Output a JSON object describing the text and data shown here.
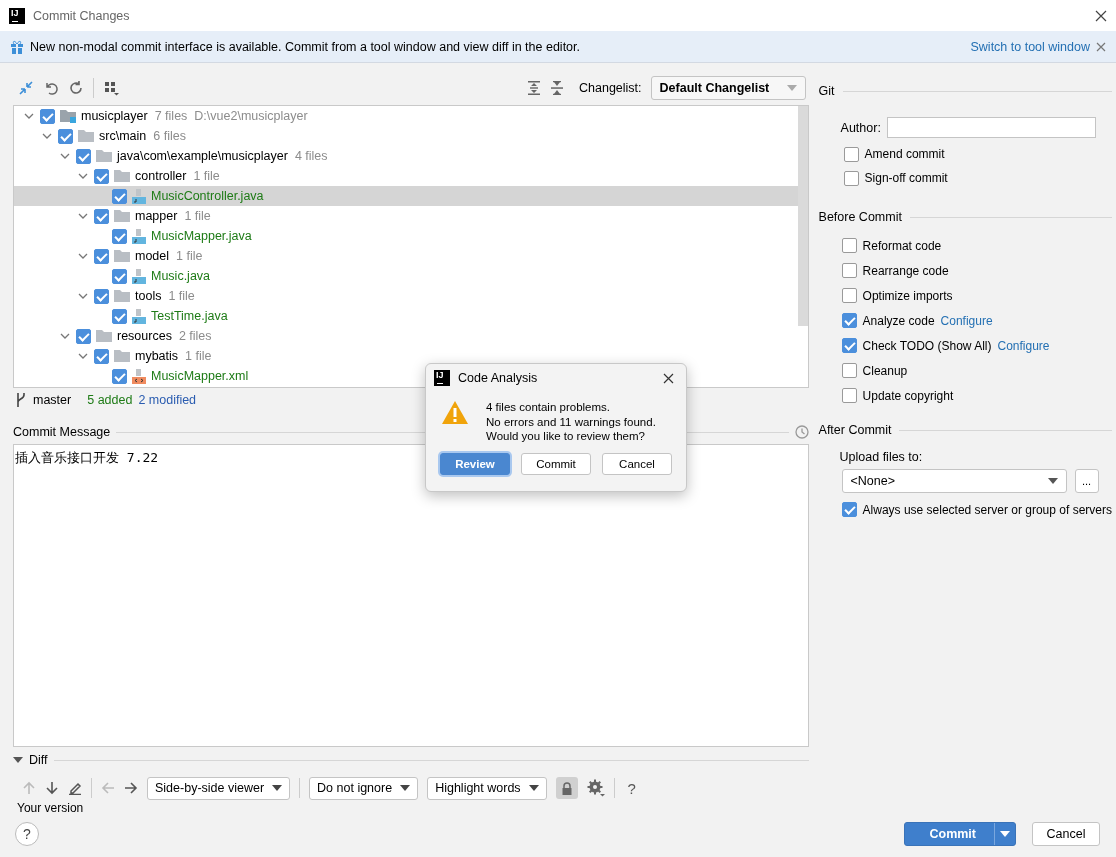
{
  "window": {
    "logo": "IJ",
    "title": "Commit Changes"
  },
  "banner": {
    "text": "New non-modal commit interface is available. Commit from a tool window and view diff in the editor.",
    "link": "Switch to tool window"
  },
  "toolbar": {
    "changelist_label": "Changelist:",
    "changelist": "Default Changelist"
  },
  "tree": [
    {
      "kind": "module",
      "name": "musicplayer",
      "count": "7 files",
      "path": "D:\\vue2\\musicplayer",
      "checked": true,
      "expanded": true,
      "selected": false,
      "children": [
        {
          "kind": "folder",
          "name": "src\\main",
          "count": "6 files",
          "checked": true,
          "expanded": true,
          "selected": false,
          "children": [
            {
              "kind": "folder",
              "name": "java\\com\\example\\musicplayer",
              "count": "4 files",
              "checked": true,
              "expanded": true,
              "selected": false,
              "children": [
                {
                  "kind": "folder",
                  "name": "controller",
                  "count": "1 file",
                  "checked": true,
                  "expanded": true,
                  "selected": false,
                  "children": [
                    {
                      "kind": "java",
                      "name": "MusicController.java",
                      "color": "#1e7b16",
                      "checked": true,
                      "selected": true
                    }
                  ]
                },
                {
                  "kind": "folder",
                  "name": "mapper",
                  "count": "1 file",
                  "checked": true,
                  "expanded": true,
                  "selected": false,
                  "children": [
                    {
                      "kind": "java",
                      "name": "MusicMapper.java",
                      "color": "#1e7b16",
                      "checked": true,
                      "selected": false
                    }
                  ]
                },
                {
                  "kind": "folder",
                  "name": "model",
                  "count": "1 file",
                  "checked": true,
                  "expanded": true,
                  "selected": false,
                  "children": [
                    {
                      "kind": "java",
                      "name": "Music.java",
                      "color": "#1e7b16",
                      "checked": true,
                      "selected": false
                    }
                  ]
                },
                {
                  "kind": "folder",
                  "name": "tools",
                  "count": "1 file",
                  "checked": true,
                  "expanded": true,
                  "selected": false,
                  "children": [
                    {
                      "kind": "java",
                      "name": "TestTime.java",
                      "color": "#1e7b16",
                      "checked": true,
                      "selected": false
                    }
                  ]
                }
              ]
            },
            {
              "kind": "folder",
              "name": "resources",
              "count": "2 files",
              "checked": true,
              "expanded": true,
              "selected": false,
              "children": [
                {
                  "kind": "folder",
                  "name": "mybatis",
                  "count": "1 file",
                  "checked": true,
                  "expanded": true,
                  "selected": false,
                  "children": [
                    {
                      "kind": "xml",
                      "name": "MusicMapper.xml",
                      "color": "#1e7b16",
                      "checked": true,
                      "selected": false
                    }
                  ]
                }
              ]
            }
          ]
        }
      ]
    }
  ],
  "branch_bar": {
    "branch": "master",
    "added": "5 added",
    "modified": "2 modified"
  },
  "commit_message": {
    "label": "Commit Message",
    "value": "插入音乐接口开发 7.22"
  },
  "diff": {
    "label": "Diff",
    "expanded": true,
    "viewer": "Side-by-side viewer",
    "ignore": "Do not ignore",
    "highlight": "Highlight words",
    "help": "?",
    "caption": "Your version"
  },
  "git": {
    "title": "Git",
    "author_label": "Author:",
    "options": [
      {
        "label": "Amend commit",
        "checked": false
      },
      {
        "label": "Sign-off commit",
        "checked": false
      }
    ]
  },
  "before_commit": {
    "title": "Before Commit",
    "options": [
      {
        "label": "Reformat code",
        "checked": false
      },
      {
        "label": "Rearrange code",
        "checked": false
      },
      {
        "label": "Optimize imports",
        "checked": false
      },
      {
        "label": "Analyze code",
        "checked": true,
        "link": "Configure"
      },
      {
        "label": "Check TODO (Show All)",
        "checked": true,
        "link": "Configure"
      },
      {
        "label": "Cleanup",
        "checked": false
      },
      {
        "label": "Update copyright",
        "checked": false
      }
    ]
  },
  "after_commit": {
    "title": "After Commit",
    "upload_label": "Upload files to:",
    "upload_target": "<None>",
    "browse": "...",
    "options": [
      {
        "label": "Always use selected server or group of servers",
        "checked": true
      }
    ]
  },
  "footer": {
    "help": "?",
    "commit": "Commit",
    "cancel": "Cancel"
  },
  "dialog": {
    "logo": "IJ",
    "title": "Code Analysis",
    "message": [
      "4 files contain problems.",
      "No errors and 11 warnings found.",
      "Would you like to review them?"
    ],
    "buttons": [
      {
        "label": "Review",
        "default": true
      },
      {
        "label": "Commit",
        "default": false
      },
      {
        "label": "Cancel",
        "default": false
      }
    ]
  }
}
